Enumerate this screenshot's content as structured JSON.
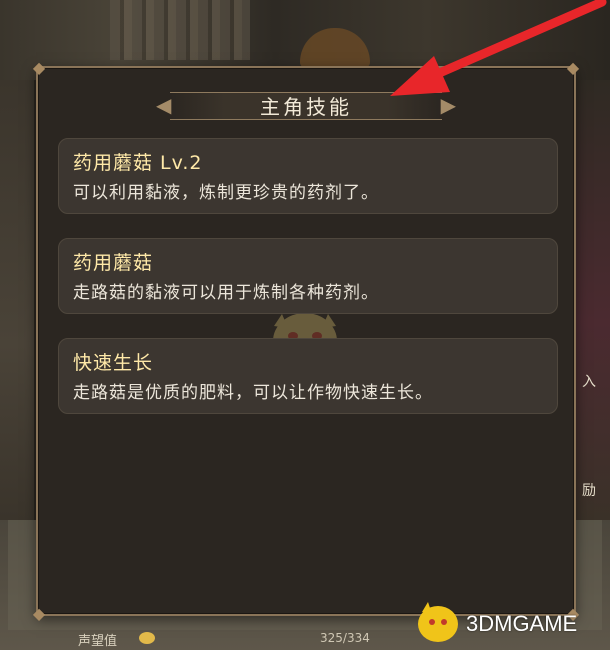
{
  "dialog": {
    "title": "主角技能",
    "skills": [
      {
        "name": "药用蘑菇 Lv.2",
        "description": "可以利用黏液，炼制更珍贵的药剂了。"
      },
      {
        "name": "药用蘑菇",
        "description": "走路菇的黏液可以用于炼制各种药剂。"
      },
      {
        "name": "快速生长",
        "description": "走路菇是优质的肥料，可以让作物快速生长。"
      }
    ]
  },
  "footer": {
    "reputation_label": "声望值",
    "reputation_value": "325/334",
    "reputation_progress": 0.973
  },
  "side_labels": {
    "right_upper": "入",
    "right_lower": "励"
  },
  "watermark": {
    "text": "3DMGAME"
  },
  "colors": {
    "panel_bg": "#2b2621",
    "card_bg": "#3c3630",
    "skill_name": "#ffe9a8",
    "arrow": "#e8262a"
  }
}
